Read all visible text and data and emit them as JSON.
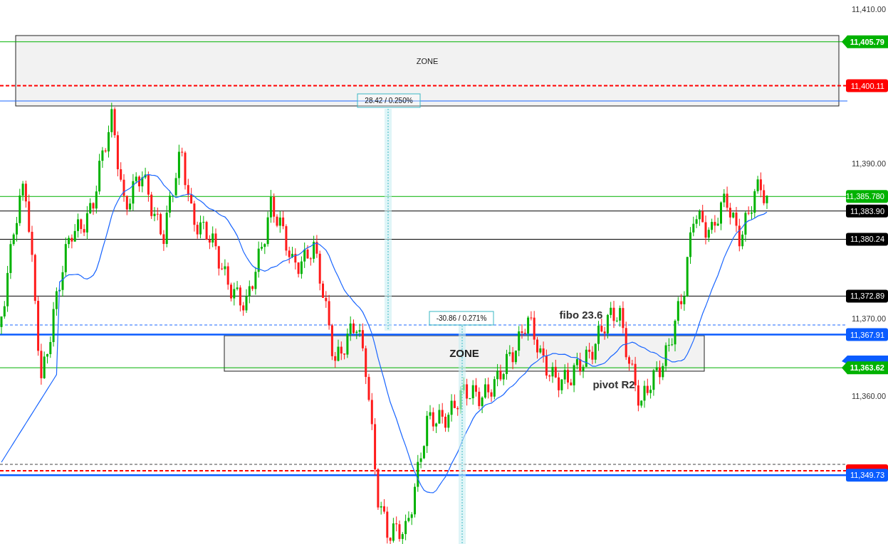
{
  "axis": {
    "ticks": [
      "11,410.00",
      "11,390.00",
      "11,370.00",
      "11,360.00"
    ]
  },
  "zones": [
    {
      "label": "ZONE"
    },
    {
      "label": "ZONE"
    }
  ],
  "measures": [
    {
      "text": "28.42 / 0.250%"
    },
    {
      "text": "-30.86 / 0.271%"
    }
  ],
  "annotations": [
    {
      "text": "fibo 23.6"
    },
    {
      "text": "pivot R2"
    }
  ],
  "levels": [
    {
      "label": "11,405.79",
      "kind": "arrow",
      "dashed": false,
      "thick": false,
      "color": "#00b200"
    },
    {
      "label": "11,400.11",
      "kind": "box",
      "dashed": true,
      "thick": false,
      "color": "#ff0000"
    },
    {
      "label": "11,385.780",
      "kind": "box",
      "dashed": false,
      "thick": false,
      "color": "#00b200"
    },
    {
      "label": "11,383.90",
      "kind": "box",
      "dashed": false,
      "thick": false,
      "color": "#000000"
    },
    {
      "label": "11,380.24",
      "kind": "box",
      "dashed": false,
      "thick": false,
      "color": "#000000"
    },
    {
      "label": "11,372.89",
      "kind": "box",
      "dashed": false,
      "thick": false,
      "color": "#000000"
    },
    {
      "label": "11,367.91",
      "kind": "box",
      "dashed": false,
      "thick": true,
      "color": "#0a5cff"
    },
    {
      "label": "11,363.62",
      "kind": "arrow",
      "dashed": false,
      "thick": false,
      "color": "#00b200"
    },
    {
      "label": "11,349.73",
      "kind": "box",
      "dashed": false,
      "thick": true,
      "color": "#0a5cff"
    }
  ]
}
